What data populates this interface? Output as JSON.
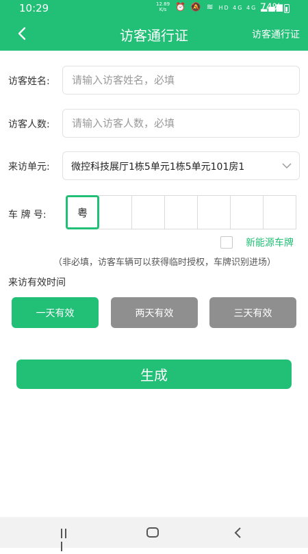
{
  "status_bar": {
    "time": "10:29",
    "speed_value": "12.89",
    "speed_unit": "K/s",
    "network": "HD 4G 4G",
    "battery": "74%"
  },
  "nav": {
    "title": "访客通行证",
    "right_label": "访客通行证"
  },
  "form": {
    "name_label": "访客姓名:",
    "name_placeholder": "请输入访客姓名，必填",
    "count_label": "访客人数:",
    "count_placeholder": "请输入访客人数，必填",
    "unit_label": "来访单元:",
    "unit_value": "微控科技展厅1栋5单元1栋5单元101房1",
    "plate_label": "车 牌 号:",
    "plate_cells": [
      "粤",
      "",
      "",
      "",
      "",
      "",
      ""
    ],
    "new_energy_label": "新能源车牌",
    "note": "（非必填，访客车辆可以获得临时授权，车牌识别进场）",
    "valid_time_label": "来访有效时间"
  },
  "durations": [
    {
      "label": "一天有效",
      "selected": true
    },
    {
      "label": "两天有效",
      "selected": false
    },
    {
      "label": "三天有效",
      "selected": false
    }
  ],
  "generate_label": "生成",
  "colors": {
    "accent": "#22bf76",
    "unselected": "#8f8f8f"
  }
}
